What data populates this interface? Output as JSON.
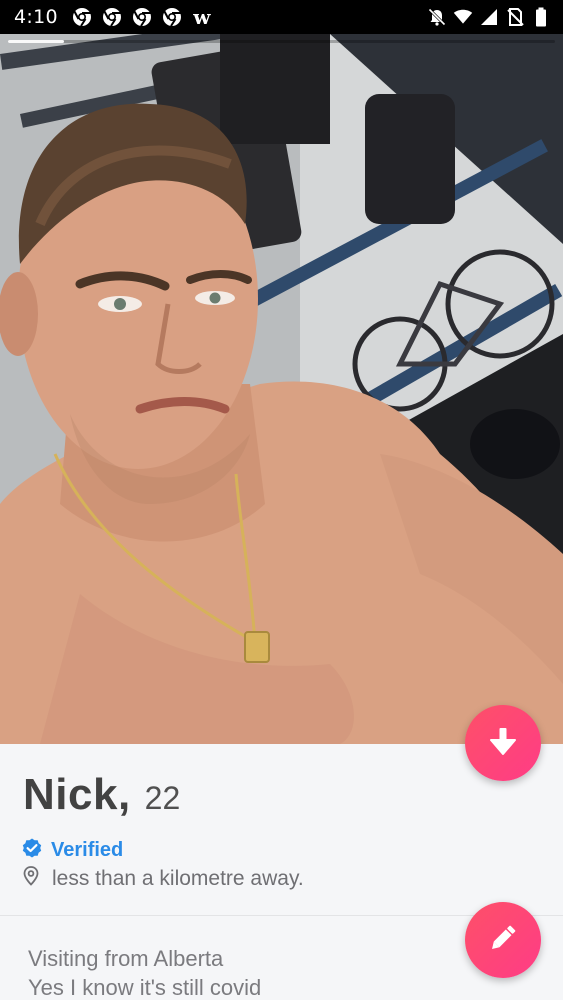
{
  "status_bar": {
    "time": "4:10",
    "notification_icons": [
      "chrome-icon",
      "chrome-icon",
      "chrome-icon",
      "chrome-icon",
      "w-app-icon"
    ],
    "notif_w": "w",
    "right_icons": [
      "do-not-disturb-icon",
      "wifi-icon",
      "signal-icon",
      "no-sim-icon",
      "battery-icon"
    ]
  },
  "photo": {
    "photo_count_visible": 1
  },
  "profile": {
    "name": "Nick,",
    "age": "22",
    "verified_label": "Verified",
    "distance": "less than a kilometre away.",
    "bio_lines": [
      "Visiting from Alberta",
      "Yes I know it's still covid"
    ]
  },
  "colors": {
    "accent_gradient_start": "#fd5068",
    "accent_gradient_end": "#ff3c86",
    "verified_blue": "#2a8be7",
    "panel_bg": "#f5f6f8"
  },
  "buttons": {
    "collapse_icon": "arrow-down-icon",
    "edit_icon": "pencil-icon"
  }
}
